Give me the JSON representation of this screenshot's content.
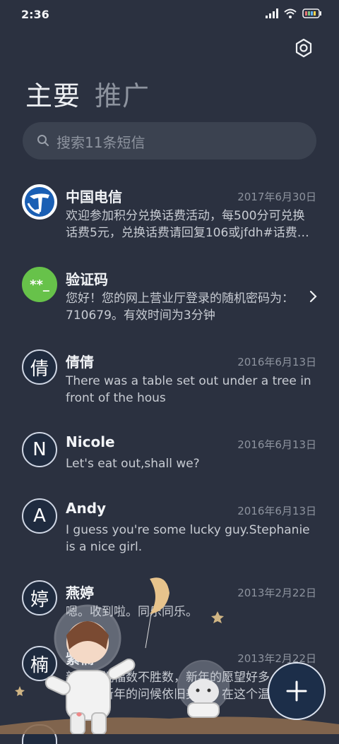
{
  "status_bar": {
    "time": "2:36"
  },
  "tabs": [
    {
      "label": "主要"
    },
    {
      "label": "推广"
    }
  ],
  "search": {
    "placeholder": "搜索11条短信"
  },
  "conversations": [
    {
      "avatar": "",
      "avatar_type": "logo",
      "name": "中国电信",
      "date": "2017年6月30日",
      "preview": "欢迎参加积分兑换话费活动，每500分可兑换话费5元，兑换话费请回复106或jfdh#话费…"
    },
    {
      "avatar": "**_",
      "avatar_type": "green",
      "name": "验证码",
      "date": "",
      "preview": "您好！您的网上营业厅登录的随机密码为：710679。有效时间为3分钟"
    },
    {
      "avatar": "倩",
      "avatar_type": "letter",
      "name": "倩倩",
      "date": "2016年6月13日",
      "preview": "There was a table set out under a tree in front of the hous"
    },
    {
      "avatar": "N",
      "avatar_type": "letter",
      "name": "Nicole",
      "date": "2016年6月13日",
      "preview": "Let's eat out,shall we?"
    },
    {
      "avatar": "A",
      "avatar_type": "letter",
      "name": "Andy",
      "date": "2016年6月13日",
      "preview": "I guess you're some lucky guy.Stephanie is a nice girl."
    },
    {
      "avatar": "婷",
      "avatar_type": "letter",
      "name": "燕婷",
      "date": "2013年2月22日",
      "preview": "嗯。收到啦。同乐同乐。"
    },
    {
      "avatar": "楠",
      "avatar_type": "letter",
      "name": "紫楠",
      "date": "2013年2月22日",
      "preview": "新年的祝福数不胜数，新年的愿望好多好多，新年的问候依旧美好，在这个温馨的日子"
    }
  ],
  "colors": {
    "background": "#2b3140",
    "accent_green": "#67c24a",
    "fab_bg": "#1c2e49"
  },
  "icons": {
    "settings": "gear-icon",
    "search": "search-icon",
    "compose": "plus-icon"
  }
}
